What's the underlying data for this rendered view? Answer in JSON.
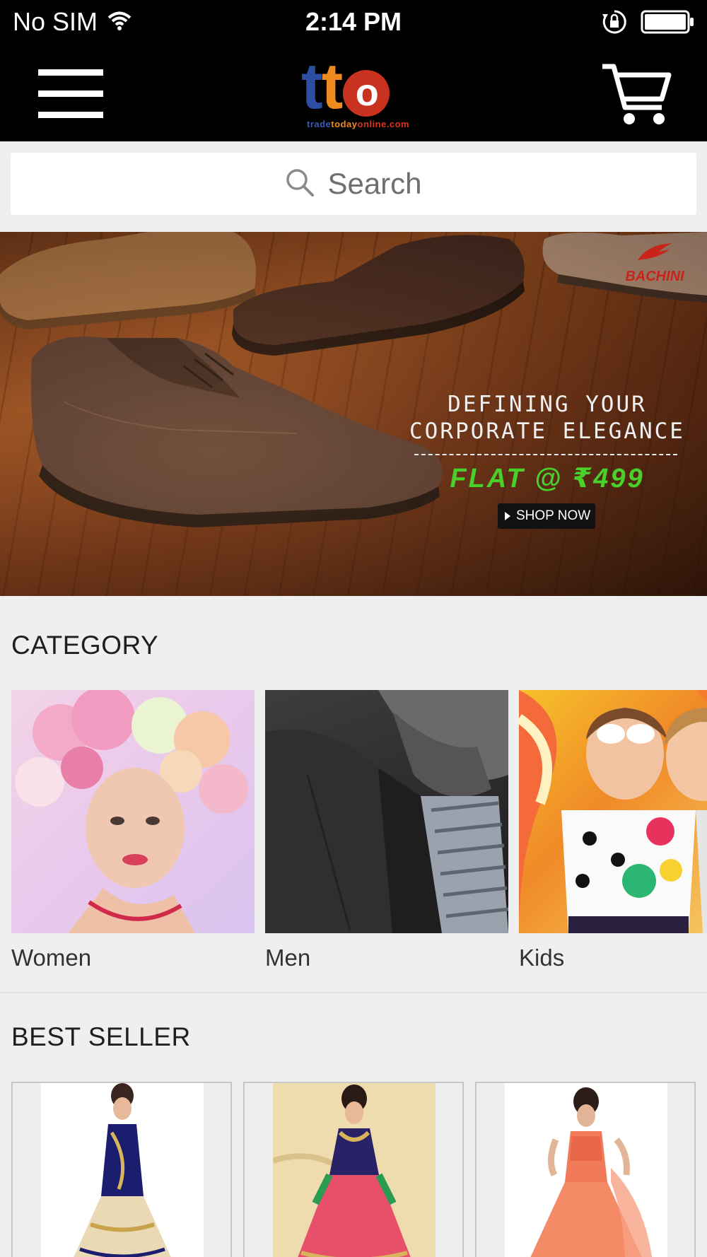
{
  "status_bar": {
    "carrier": "No SIM",
    "time": "2:14 PM"
  },
  "header": {
    "logo_letters": "tto",
    "logo_sub_a": "trade",
    "logo_sub_b": "today",
    "logo_sub_c": "online.com"
  },
  "search": {
    "placeholder": "Search"
  },
  "banner": {
    "brand": "BACHINI",
    "line1": "DEFINING YOUR",
    "line2": "CORPORATE ELEGANCE",
    "offer": "FLAT @ ₹499",
    "cta": "SHOP NOW"
  },
  "category": {
    "title": "CATEGORY",
    "items": [
      {
        "label": "Women"
      },
      {
        "label": "Men"
      },
      {
        "label": "Kids"
      }
    ]
  },
  "best_seller": {
    "title": "BEST SELLER"
  },
  "colors": {
    "bar_bg": "#000000",
    "page_bg": "#efefef",
    "offer_green": "#49d12b"
  }
}
